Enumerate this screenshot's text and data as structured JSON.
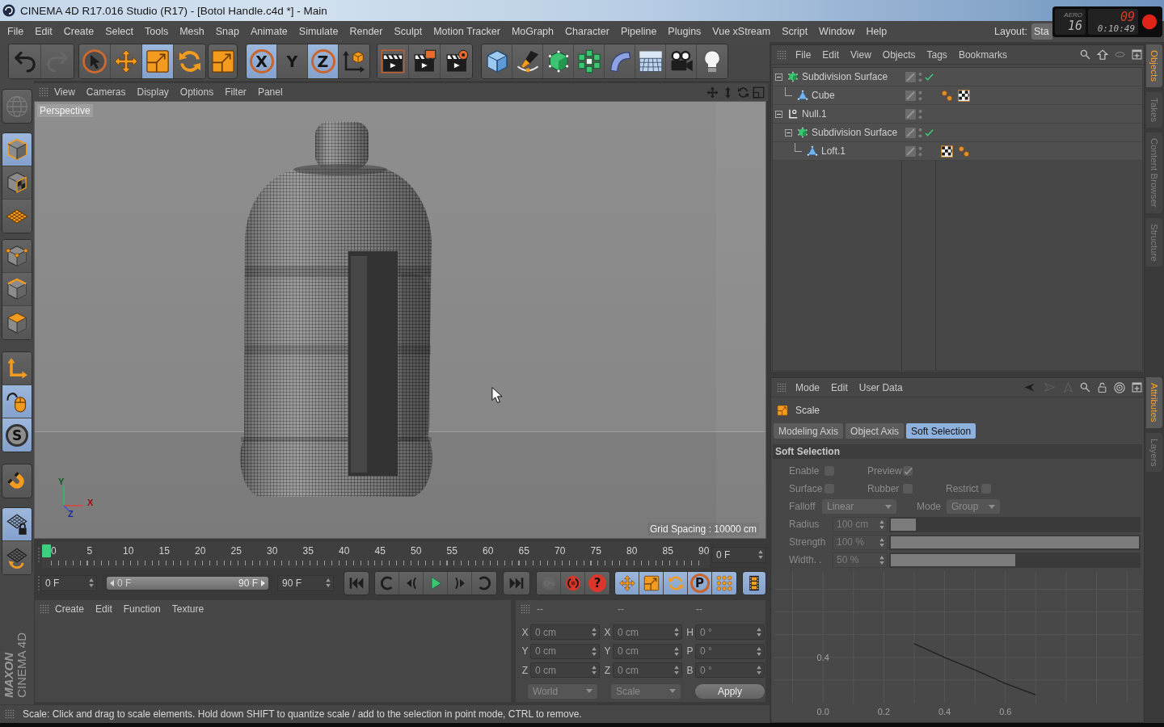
{
  "window": {
    "title": "CINEMA 4D R17.016 Studio (R17) - [Botol Handle.c4d *] - Main"
  },
  "recorder_overlay": {
    "label": "AERO",
    "fps": "16",
    "frames": "09",
    "time": "0:10:49"
  },
  "menu_bar": {
    "items": [
      "File",
      "Edit",
      "Create",
      "Select",
      "Tools",
      "Mesh",
      "Snap",
      "Animate",
      "Simulate",
      "Render",
      "Sculpt",
      "Motion Tracker",
      "MoGraph",
      "Character",
      "Pipeline",
      "Plugins",
      "Vue xStream",
      "Script",
      "Window",
      "Help"
    ],
    "layout": {
      "label": "Layout:",
      "value": "Sta"
    }
  },
  "toolbar": {
    "groups": [
      [
        {
          "selected": false,
          "disabled": false
        },
        {
          "selected": false,
          "disabled": true
        }
      ],
      [
        {
          "selected": false,
          "disabled": false
        },
        {
          "selected": false,
          "disabled": false
        },
        {
          "selected": true,
          "disabled": false
        },
        {
          "selected": false,
          "disabled": false
        }
      ],
      [
        {
          "selected": false,
          "disabled": false
        }
      ],
      [
        {
          "label": "X",
          "selected": true,
          "disabled": false
        },
        {
          "label": "Y",
          "selected": false,
          "disabled": false
        },
        {
          "label": "Z",
          "selected": true,
          "disabled": false
        },
        {
          "selected": false,
          "disabled": false
        }
      ],
      [
        {
          "selected": false,
          "disabled": false
        },
        {
          "selected": false,
          "disabled": false
        },
        {
          "selected": false,
          "disabled": false
        }
      ],
      [
        {
          "selected": false,
          "disabled": false
        },
        {
          "selected": false,
          "disabled": false
        },
        {
          "selected": false,
          "disabled": false
        },
        {
          "selected": false,
          "disabled": false
        },
        {
          "selected": false,
          "disabled": false
        },
        {
          "selected": false,
          "disabled": false
        },
        {
          "selected": false,
          "disabled": false
        },
        {
          "selected": false,
          "disabled": false
        }
      ]
    ]
  },
  "mode_toolbar": {
    "groups": [
      [
        {
          "selected": false,
          "disabled": true
        }
      ],
      [
        {
          "selected": true,
          "disabled": false
        },
        {
          "selected": false,
          "disabled": false
        },
        {
          "selected": false,
          "disabled": false
        }
      ],
      [
        {
          "selected": false,
          "disabled": false
        },
        {
          "selected": false,
          "disabled": false
        },
        {
          "selected": false,
          "disabled": false
        }
      ],
      [
        {
          "selected": false,
          "disabled": false
        },
        {
          "selected": true,
          "disabled": false
        },
        {
          "label": "S",
          "selected": true,
          "disabled": false
        }
      ],
      [
        {
          "selected": false,
          "disabled": false
        }
      ],
      [
        {
          "selected": true,
          "disabled": false
        },
        {
          "selected": false,
          "disabled": false
        }
      ]
    ]
  },
  "viewport": {
    "menu": [
      "View",
      "Cameras",
      "Display",
      "Options",
      "Filter",
      "Panel"
    ],
    "camera": "Perspective",
    "axis_labels": [
      "Y",
      "X",
      "Z"
    ],
    "grid_spacing": "Grid Spacing : 10000 cm"
  },
  "timeline": {
    "ticks": [
      "0",
      "5",
      "10",
      "15",
      "20",
      "25",
      "30",
      "35",
      "40",
      "45",
      "50",
      "55",
      "60",
      "65",
      "70",
      "75",
      "80",
      "85",
      "90"
    ],
    "playhead": {
      "level": 0
    },
    "current_frame": "0 F"
  },
  "transport": {
    "start_field": "0 F",
    "range": {
      "start": "0 F",
      "end": "90 F",
      "level": 1
    },
    "end_field": "90 F",
    "groups": [
      [
        {
          "selected": false,
          "disabled": false
        }
      ],
      [
        {
          "selected": false,
          "disabled": false
        },
        {
          "selected": false,
          "disabled": false
        },
        {
          "selected": false,
          "disabled": false
        },
        {
          "selected": false,
          "disabled": false
        },
        {
          "selected": false,
          "disabled": false
        }
      ],
      [
        {
          "selected": false,
          "disabled": false
        }
      ],
      [
        {
          "selected": false,
          "disabled": true
        },
        {
          "selected": false,
          "disabled": false
        },
        {
          "label": "?",
          "selected": false,
          "disabled": false
        }
      ],
      [
        {
          "selected": true,
          "disabled": false
        },
        {
          "selected": true,
          "disabled": false
        },
        {
          "selected": true,
          "disabled": false
        },
        {
          "label": "P",
          "selected": true,
          "disabled": false
        },
        {
          "selected": true,
          "disabled": false
        }
      ],
      [
        {
          "selected": true,
          "disabled": false
        }
      ]
    ]
  },
  "material_manager": {
    "menu": [
      "Create",
      "Edit",
      "Function",
      "Texture"
    ]
  },
  "coordinates": {
    "headers": [
      "--",
      "--",
      "--"
    ],
    "rows": [
      {
        "position_axis": "X",
        "position": "0 cm",
        "size_axis": "X",
        "size": "0 cm",
        "rotation_axis": "H",
        "rotation": "0 °"
      },
      {
        "position_axis": "Y",
        "position": "0 cm",
        "size_axis": "Y",
        "size": "0 cm",
        "rotation_axis": "P",
        "rotation": "0 °"
      },
      {
        "position_axis": "Z",
        "position": "0 cm",
        "size_axis": "Z",
        "size": "0 cm",
        "rotation_axis": "B",
        "rotation": "0 °"
      }
    ],
    "coordinate_system": "World",
    "transform_mode": "Scale",
    "apply": "Apply"
  },
  "logo": {
    "brand": "MAXON",
    "product": "CINEMA 4D"
  },
  "status_bar": {
    "text": "Scale: Click and drag to scale elements. Hold down SHIFT to quantize scale / add to the selection in point mode, CTRL to remove."
  },
  "object_manager": {
    "menu": [
      "File",
      "Edit",
      "View",
      "Objects",
      "Tags",
      "Bookmarks"
    ],
    "objects": [
      {
        "name": "Subdivision Surface",
        "kind": "generator",
        "expanded": true,
        "enabled": true,
        "children": [
          {
            "name": "Cube",
            "kind": "polygon",
            "enabled": false,
            "tags": [
              {
                "kind": "phong"
              },
              {
                "kind": "material"
              }
            ]
          }
        ]
      },
      {
        "name": "Null.1",
        "kind": "null",
        "expanded": true,
        "enabled": false,
        "children": [
          {
            "name": "Subdivision Surface",
            "kind": "generator",
            "expanded": true,
            "enabled": true,
            "children": [
              {
                "name": "Loft.1",
                "kind": "polygon",
                "enabled": false,
                "tags": [
                  {
                    "kind": "material"
                  },
                  {
                    "kind": "phong"
                  }
                ]
              }
            ]
          }
        ]
      }
    ]
  },
  "object_tabs": [
    {
      "label": "Objects",
      "selected": true
    },
    {
      "label": "Takes",
      "selected": false
    },
    {
      "label": "Content Browser",
      "selected": false
    },
    {
      "label": "Structure",
      "selected": false
    }
  ],
  "attributes": {
    "menu": [
      "Mode",
      "Edit",
      "User Data"
    ],
    "tool": "Scale",
    "tabs": [
      {
        "label": "Modeling Axis",
        "selected": false
      },
      {
        "label": "Object Axis",
        "selected": false
      },
      {
        "label": "Soft Selection",
        "selected": true
      }
    ],
    "section": "Soft Selection",
    "disabled": true,
    "options": [
      [
        {
          "label": "Enable",
          "checked": false
        },
        {
          "label": "Preview",
          "checked": true
        }
      ],
      [
        {
          "label": "Surface",
          "checked": false
        },
        {
          "label": "Rubber",
          "checked": false
        },
        {
          "label": "Restrict",
          "checked": false
        }
      ]
    ],
    "falloff": {
      "label": "Falloff",
      "value": "Linear"
    },
    "mode": {
      "label": "Mode",
      "value": "Group"
    },
    "sliders": [
      {
        "label": "Radius",
        "value": "100 cm",
        "level": 0.1
      },
      {
        "label": "Strength",
        "value": "100 %",
        "level": 1
      },
      {
        "label": "Width. .",
        "value": "50 %",
        "level": 0.5
      }
    ],
    "falloff_graph": {
      "y_label": "0.4",
      "x_labels": [
        "0.0",
        "0.2",
        "0.4",
        "0.6"
      ]
    }
  },
  "attribute_tabs": [
    {
      "label": "Attributes",
      "selected": true
    },
    {
      "label": "Layers",
      "selected": false
    }
  ]
}
